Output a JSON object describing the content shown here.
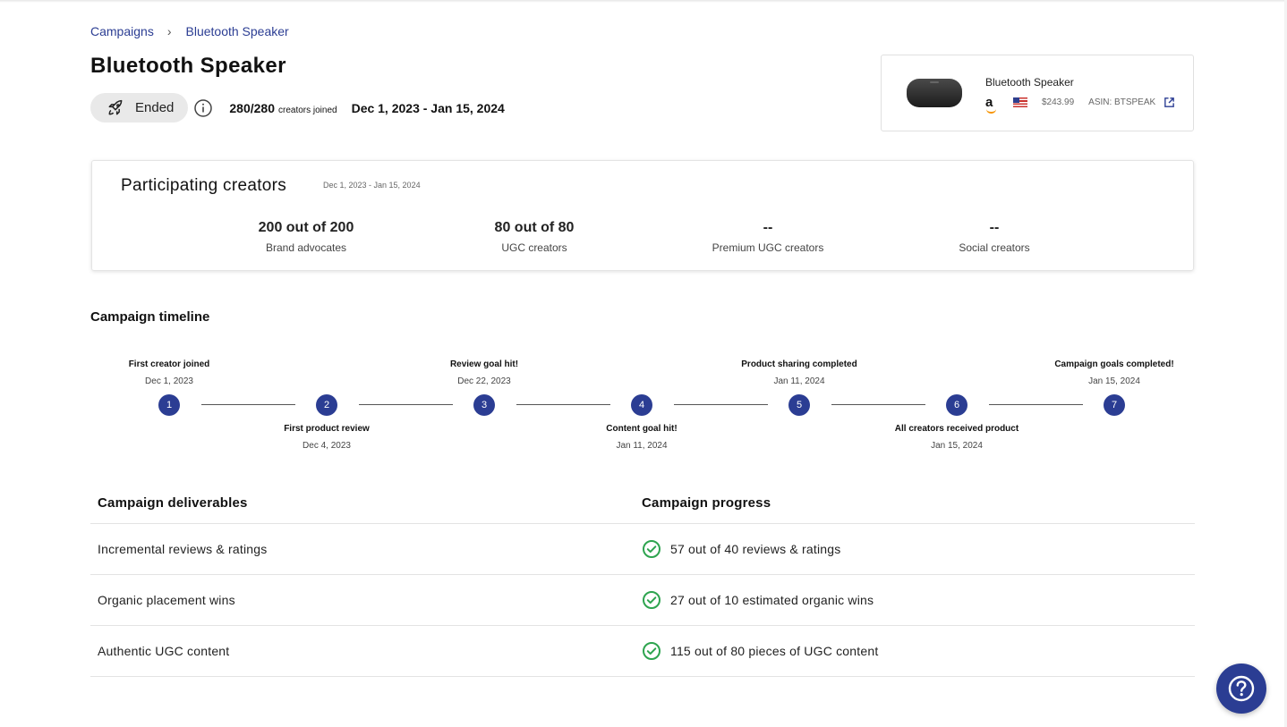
{
  "breadcrumb": {
    "root": "Campaigns",
    "current": "Bluetooth Speaker"
  },
  "page": {
    "title": "Bluetooth Speaker"
  },
  "status": {
    "label": "Ended",
    "icon": "rocket-icon"
  },
  "creators_joined": {
    "count": "280/280",
    "label": "creators joined"
  },
  "date_range": "Dec 1, 2023 - Jan 15, 2024",
  "product": {
    "name": "Bluetooth Speaker",
    "price": "$243.99",
    "asin": "ASIN: BTSPEAK",
    "marketplace_icon": "amazon-icon",
    "country_icon": "us-flag-icon"
  },
  "participating": {
    "title": "Participating creators",
    "date": "Dec 1, 2023 - Jan 15, 2024",
    "stats": [
      {
        "value": "200 out of 200",
        "label": "Brand advocates"
      },
      {
        "value": "80 out of 80",
        "label": "UGC creators"
      },
      {
        "value": "--",
        "label": "Premium UGC creators"
      },
      {
        "value": "--",
        "label": "Social creators"
      }
    ]
  },
  "timeline": {
    "title": "Campaign timeline",
    "events": [
      {
        "n": "1",
        "title": "First creator joined",
        "date": "Dec 1, 2023"
      },
      {
        "n": "2",
        "title": "First product review",
        "date": "Dec 4, 2023"
      },
      {
        "n": "3",
        "title": "Review goal hit!",
        "date": "Dec 22, 2023"
      },
      {
        "n": "4",
        "title": "Content goal hit!",
        "date": "Jan 11, 2024"
      },
      {
        "n": "5",
        "title": "Product sharing completed",
        "date": "Jan 11, 2024"
      },
      {
        "n": "6",
        "title": "All creators received product",
        "date": "Jan 15, 2024"
      },
      {
        "n": "7",
        "title": "Campaign goals completed!",
        "date": "Jan 15, 2024"
      }
    ]
  },
  "deliverables": {
    "header_left": "Campaign deliverables",
    "header_right": "Campaign progress",
    "rows": [
      {
        "name": "Incremental reviews & ratings",
        "progress": "57 out of 40 reviews & ratings"
      },
      {
        "name": "Organic placement wins",
        "progress": "27 out of 10 estimated organic wins"
      },
      {
        "name": "Authentic UGC content",
        "progress": "115 out of 80 pieces of UGC content"
      }
    ]
  },
  "colors": {
    "accent": "#2b3d93",
    "success": "#2ea44f"
  },
  "help": {
    "icon": "help-icon"
  }
}
